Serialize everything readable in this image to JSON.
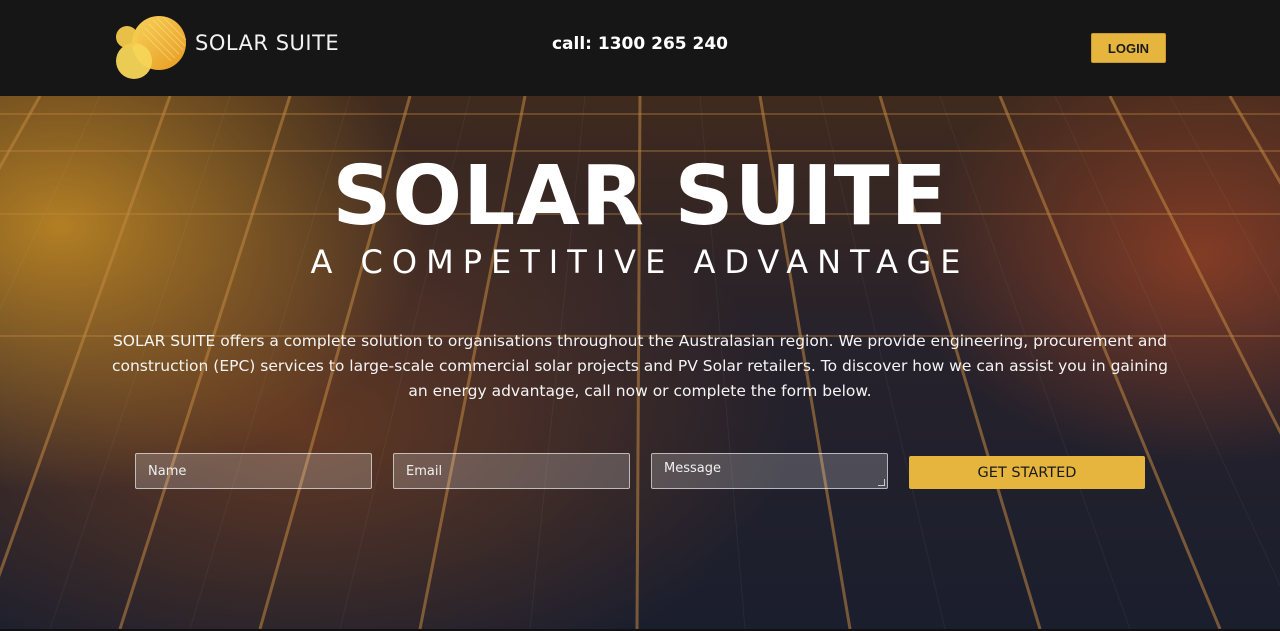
{
  "header": {
    "logo_text_light": "SOLAR",
    "logo_text_bold": "SUITE",
    "phone": "call: 1300 265 240",
    "login_label": "LOGIN"
  },
  "hero": {
    "title": "SOLAR SUITE",
    "subtitle": "A COMPETITIVE ADVANTAGE",
    "description": "SOLAR SUITE offers a complete solution to organisations throughout the Australasian region. We provide engineering, procurement and construction (EPC) services to large-scale commercial solar projects and PV Solar retailers. To discover how we can assist you in gaining an energy advantage, call now or complete the form below."
  },
  "form": {
    "name_placeholder": "Name",
    "email_placeholder": "Email",
    "message_placeholder": "Message",
    "submit_label": "GET STARTED"
  },
  "colors": {
    "accent": "#e6b53e",
    "header_bg": "#161616"
  }
}
